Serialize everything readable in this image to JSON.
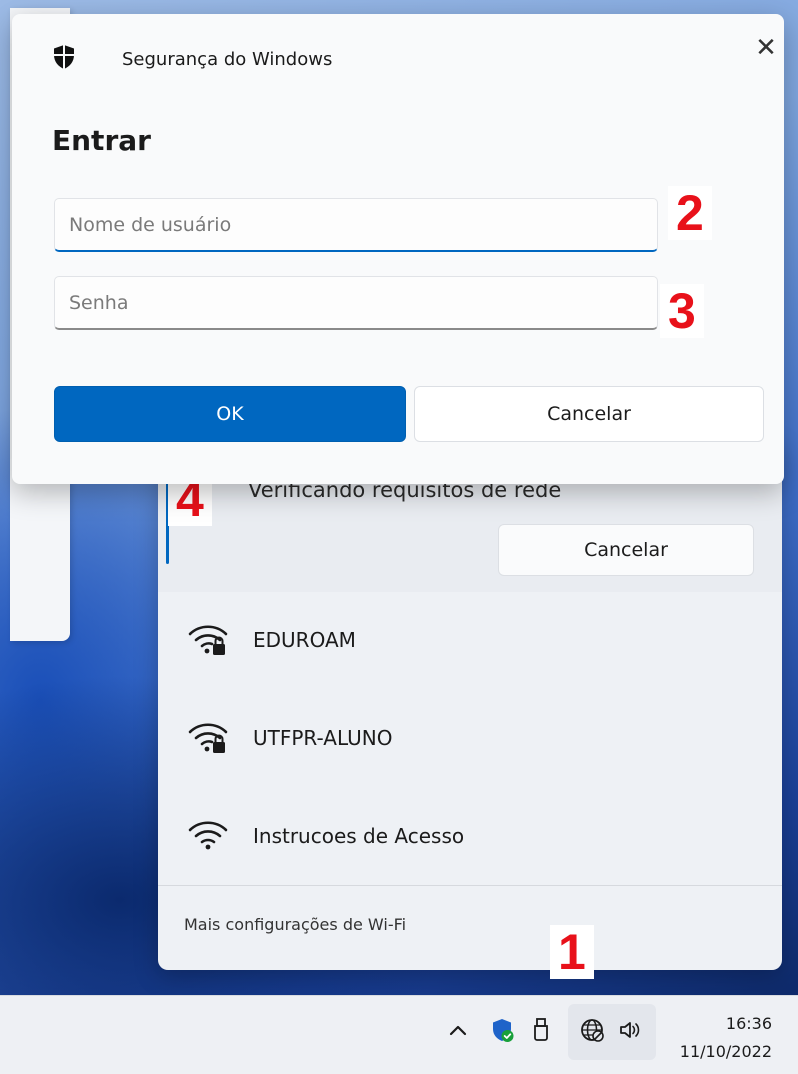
{
  "dialog": {
    "app_name": "Segurança do Windows",
    "heading": "Entrar",
    "username_placeholder": "Nome de usuário",
    "username_value": "",
    "password_placeholder": "Senha",
    "password_value": "",
    "ok_label": "OK",
    "cancel_label": "Cancelar",
    "close_symbol": "✕"
  },
  "wifi_flyout": {
    "connecting_status": "Verificando requisitos de rede",
    "cancel_label": "Cancelar",
    "networks": [
      {
        "name": "EDUROAM",
        "secured": true
      },
      {
        "name": "UTFPR-ALUNO",
        "secured": true
      },
      {
        "name": "Instrucoes de Acesso",
        "secured": false
      }
    ],
    "more_settings_label": "Mais configurações de Wi-Fi"
  },
  "taskbar": {
    "time": "16:36",
    "date": "11/10/2022",
    "tray_icons": [
      "chevron-up-icon",
      "defender-icon",
      "usb-drive-icon",
      "network-icon",
      "volume-icon"
    ]
  },
  "annotations": {
    "marker_1": "1",
    "marker_2": "2",
    "marker_3": "3",
    "marker_4": "4"
  },
  "colors": {
    "accent": "#0067c0",
    "marker_red": "#e8111a"
  }
}
